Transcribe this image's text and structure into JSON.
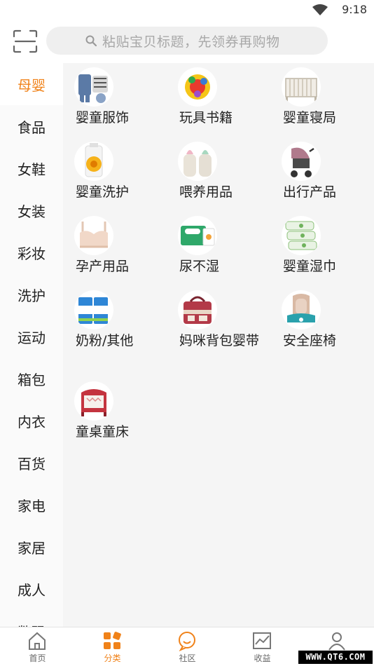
{
  "status": {
    "time": "9:18"
  },
  "search": {
    "placeholder": "粘贴宝贝标题，先领券再购物"
  },
  "sidebar": {
    "items": [
      {
        "label": "母婴",
        "active": true
      },
      {
        "label": "食品"
      },
      {
        "label": "女鞋"
      },
      {
        "label": "女装"
      },
      {
        "label": "彩妆"
      },
      {
        "label": "洗护"
      },
      {
        "label": "运动"
      },
      {
        "label": "箱包"
      },
      {
        "label": "内衣"
      },
      {
        "label": "百货"
      },
      {
        "label": "家电"
      },
      {
        "label": "家居"
      },
      {
        "label": "成人"
      },
      {
        "label": "数码"
      }
    ]
  },
  "grid": {
    "items": [
      {
        "label": "婴童服饰",
        "icon": "baby-clothes-icon"
      },
      {
        "label": "玩具书籍",
        "icon": "toy-icon"
      },
      {
        "label": "婴童寝局",
        "icon": "crib-icon"
      },
      {
        "label": "婴童洗护",
        "icon": "baby-wash-icon"
      },
      {
        "label": "喂养用品",
        "icon": "baby-bottle-icon"
      },
      {
        "label": "出行产品",
        "icon": "stroller-icon"
      },
      {
        "label": "孕产用品",
        "icon": "maternity-bra-icon"
      },
      {
        "label": "尿不湿",
        "icon": "diaper-pack-icon"
      },
      {
        "label": "婴童湿巾",
        "icon": "wet-wipes-icon"
      },
      {
        "label": "奶粉/其他",
        "icon": "milk-powder-icon"
      },
      {
        "label": "妈咪背包婴带",
        "icon": "mommy-bag-icon"
      },
      {
        "label": "安全座椅",
        "icon": "car-seat-icon"
      },
      {
        "label": "童桌童床",
        "icon": "kids-furniture-icon"
      }
    ]
  },
  "tabbar": {
    "items": [
      {
        "label": "首页",
        "icon": "home-icon"
      },
      {
        "label": "分类",
        "icon": "category-icon",
        "active": true
      },
      {
        "label": "社区",
        "icon": "community-icon"
      },
      {
        "label": "收益",
        "icon": "earnings-icon"
      },
      {
        "label": "",
        "icon": "profile-icon"
      }
    ]
  },
  "watermark": {
    "text": "WWW.QT6.COM"
  },
  "colors": {
    "accent": "#f08219",
    "search_bg": "#efefef",
    "content_bg": "#f5f5f5"
  }
}
